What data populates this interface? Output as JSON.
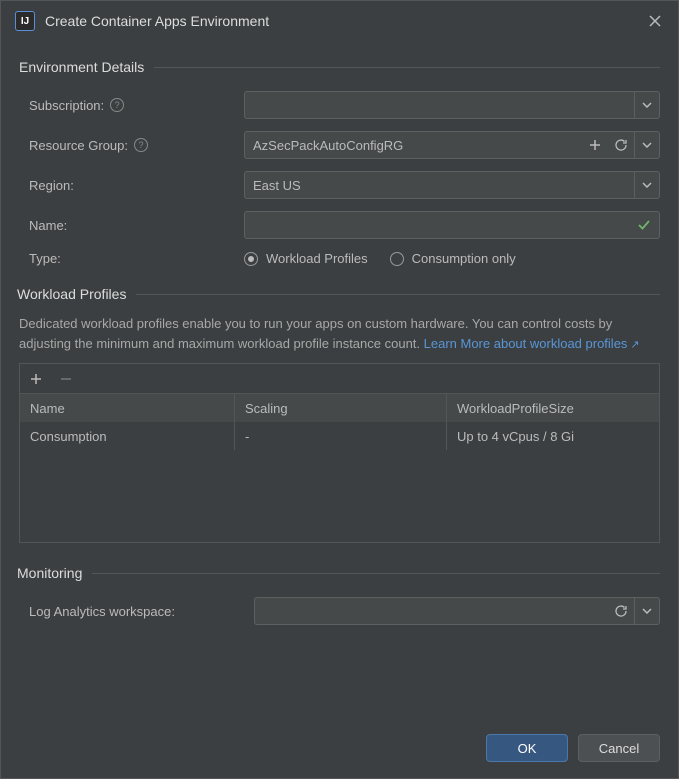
{
  "dialog": {
    "title": "Create Container Apps Environment",
    "app_icon_text": "IJ"
  },
  "sections": {
    "env_details": "Environment Details",
    "workload_profiles": "Workload Profiles",
    "monitoring": "Monitoring"
  },
  "labels": {
    "subscription": "Subscription:",
    "resource_group": "Resource Group:",
    "region": "Region:",
    "name": "Name:",
    "type": "Type:",
    "log_analytics": "Log Analytics workspace:"
  },
  "values": {
    "subscription": "",
    "resource_group": "AzSecPackAutoConfigRG",
    "region": "East US",
    "name": "",
    "log_analytics": ""
  },
  "type_options": {
    "workload_profiles": "Workload Profiles",
    "consumption_only": "Consumption only",
    "selected": "workload_profiles"
  },
  "workload_desc": {
    "text": "Dedicated workload profiles enable you to run your apps on custom hardware. You can control costs by adjusting the minimum and maximum workload profile instance count. ",
    "link_text": "Learn More about workload profiles"
  },
  "table": {
    "headers": {
      "c1": "Name",
      "c2": "Scaling",
      "c3": "WorkloadProfileSize"
    },
    "rows": [
      {
        "c1": "Consumption",
        "c2": "-",
        "c3": "Up to 4 vCpus / 8 Gi"
      }
    ]
  },
  "buttons": {
    "ok": "OK",
    "cancel": "Cancel"
  }
}
